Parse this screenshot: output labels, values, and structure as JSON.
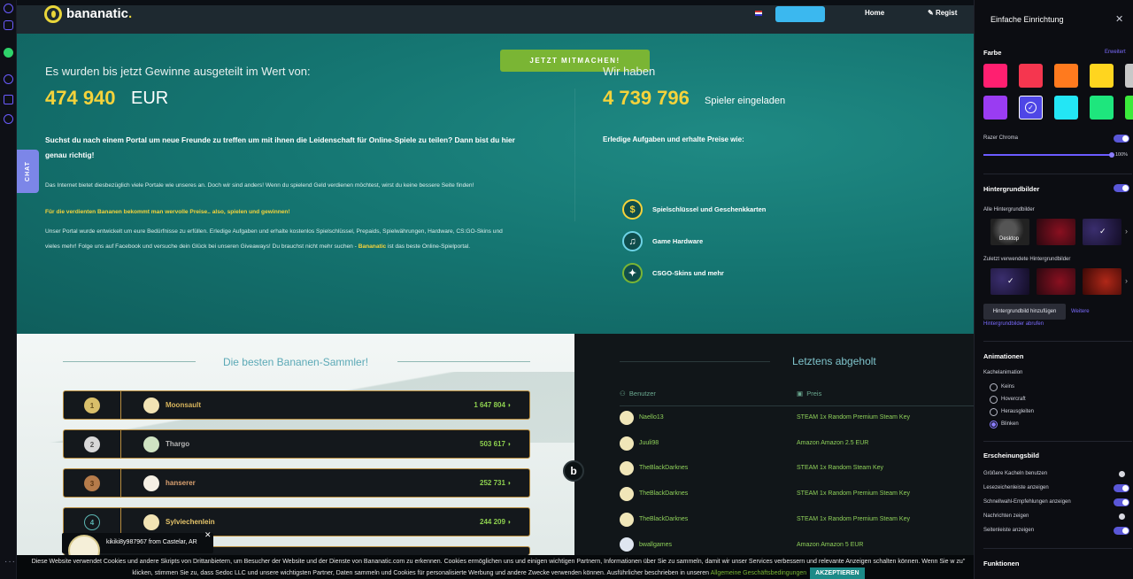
{
  "header": {
    "logo_text": "bananatic",
    "logo_dot": ".",
    "nav_home": "Home",
    "nav_register": "Regist"
  },
  "hero": {
    "join_button": "JETZT MITMACHEN!",
    "winnings_title": "Es wurden bis jetzt Gewinne ausgeteilt im Wert von:",
    "winnings_amount": "474 940",
    "winnings_currency": "EUR",
    "question": "Suchst du nach einem Portal um neue Freunde zu treffen um mit ihnen die Leidenschaft für Online-Spiele zu teilen? Dann bist du hier genau richtig!",
    "p1": "Das Internet bietet diesbezüglich viele Portale wie unseres an. Doch wir sind anders! Wenn du spielend Geld verdienen möchtest, wirst du keine bessere Seite finden!",
    "p2": "Für die verdienten Bananen bekommt man wervolle Preise.. also, spielen und gewinnen!",
    "p3_a": "Unser Portal wurde entwickelt um eure Bedürfnisse zu erfüllen. Erledige Aufgaben und erhalte kostenlos Spielschlüssel, Prepaids, Spielwährungen, Hardware, CS:GO-Skins und vieles mehr! Folge uns auf Facebook und versuche dein Glück bei unseren Giveaways! Du brauchst nicht mehr suchen - ",
    "p3_brand": "Bananatic",
    "p3_b": " ist das beste Online-Spielportal.",
    "players_title": "Wir haben",
    "players_count": "4 739 796",
    "players_label": "Spieler eingeladen",
    "tasks_title": "Erledige Aufgaben und erhalte Preise wie:",
    "features": [
      "Spielschlüssel und Geschenkkarten",
      "Game Hardware",
      "CSGO-Skins und mehr"
    ],
    "chat_tab": "CHAT"
  },
  "leaderboard": {
    "title": "Die besten Bananen-Sammler!",
    "rows": [
      {
        "rank": "1",
        "name": "Moonsault",
        "points": "1 647 804"
      },
      {
        "rank": "2",
        "name": "Thargo",
        "points": "503 617"
      },
      {
        "rank": "3",
        "name": "hanserer",
        "points": "252 731"
      },
      {
        "rank": "4",
        "name": "Sylviechenlein",
        "points": "244 209"
      }
    ]
  },
  "recent": {
    "title": "Letztens abgeholt",
    "col_user": "Benutzer",
    "col_prize": "Preis",
    "rows": [
      {
        "user": "Naello13",
        "prize": "STEAM 1x Random Premium Steam Key"
      },
      {
        "user": "Juuli98",
        "prize": "Amazon Amazon 2.5 EUR"
      },
      {
        "user": "TheBlackDarknes",
        "prize": "STEAM 1x Random Steam Key"
      },
      {
        "user": "TheBlackDarknes",
        "prize": "STEAM 1x Random Premium Steam Key"
      },
      {
        "user": "TheBlackDarknes",
        "prize": "STEAM 1x Random Premium Steam Key"
      },
      {
        "user": "bwallgames",
        "prize": "Amazon Amazon 5 EUR"
      }
    ]
  },
  "toast": {
    "text": "kikiki8y987967 from Castelar, AR"
  },
  "cookie": {
    "text": "Diese Website verwendet Cookies und andere Skripts von Drittanbietern, um Besucher der Website und der Dienste von Bananatic.com zu erkennen. Cookies ermöglichen uns und einigen wichtigen Partnern, Informationen über Sie zu sammeln, damit wir unser Services verbessern und relevante Anzeigen schalten können. Wenn Sie w zu\" klicken, stimmen Sie zu, dass Sedoc LLC und unsere wichtigsten Partner, Daten sammeln und Cookies für personalisierte Werbung und andere Zwecke verwenden können. Ausführlicher beschrieben in unseren ",
    "link": "Allgemeine Geschäftsbedingungen",
    "button": "AKZEPTIEREN"
  },
  "settings": {
    "title": "Einfache Einrichtung",
    "farbe": "Farbe",
    "erweitert": "Erweitert",
    "colors": [
      "#ff1f70",
      "#f5364f",
      "#ff7a1e",
      "#ffd51f",
      "#c8c8c8",
      "#9a3cf2",
      "#4e46e6",
      "#23e6f5",
      "#1ee67d",
      "#3bea3b"
    ],
    "razer_chroma": "Razer Chroma",
    "chroma_value": "100%",
    "hintergrundbilder": "Hintergrundbilder",
    "alle": "Alle Hintergrundbilder",
    "desktop": "Desktop",
    "zuletzt": "Zuletzt verwendete Hintergrundbilder",
    "add_bg": "Hintergrundbild hinzufügen",
    "weitere": "Weitere",
    "abrufen": "Hintergrundbilder abrufen",
    "animationen": "Animationen",
    "kachel": "Kachelanimation",
    "anim_options": [
      "Keins",
      "Hovercraft",
      "Herausgleiten",
      "Blinken"
    ],
    "erscheinung": "Erscheinungsbild",
    "appearance": [
      {
        "label": "Größere Kacheln benutzen",
        "on": false
      },
      {
        "label": "Lesezeichenleiste anzeigen",
        "on": true
      },
      {
        "label": "Schnellwahl-Empfehlungen anzeigen",
        "on": true
      },
      {
        "label": "Nachrichten zeigen",
        "on": false
      },
      {
        "label": "Seitenleiste anzeigen",
        "on": true
      }
    ],
    "funktionen": "Funktionen"
  }
}
